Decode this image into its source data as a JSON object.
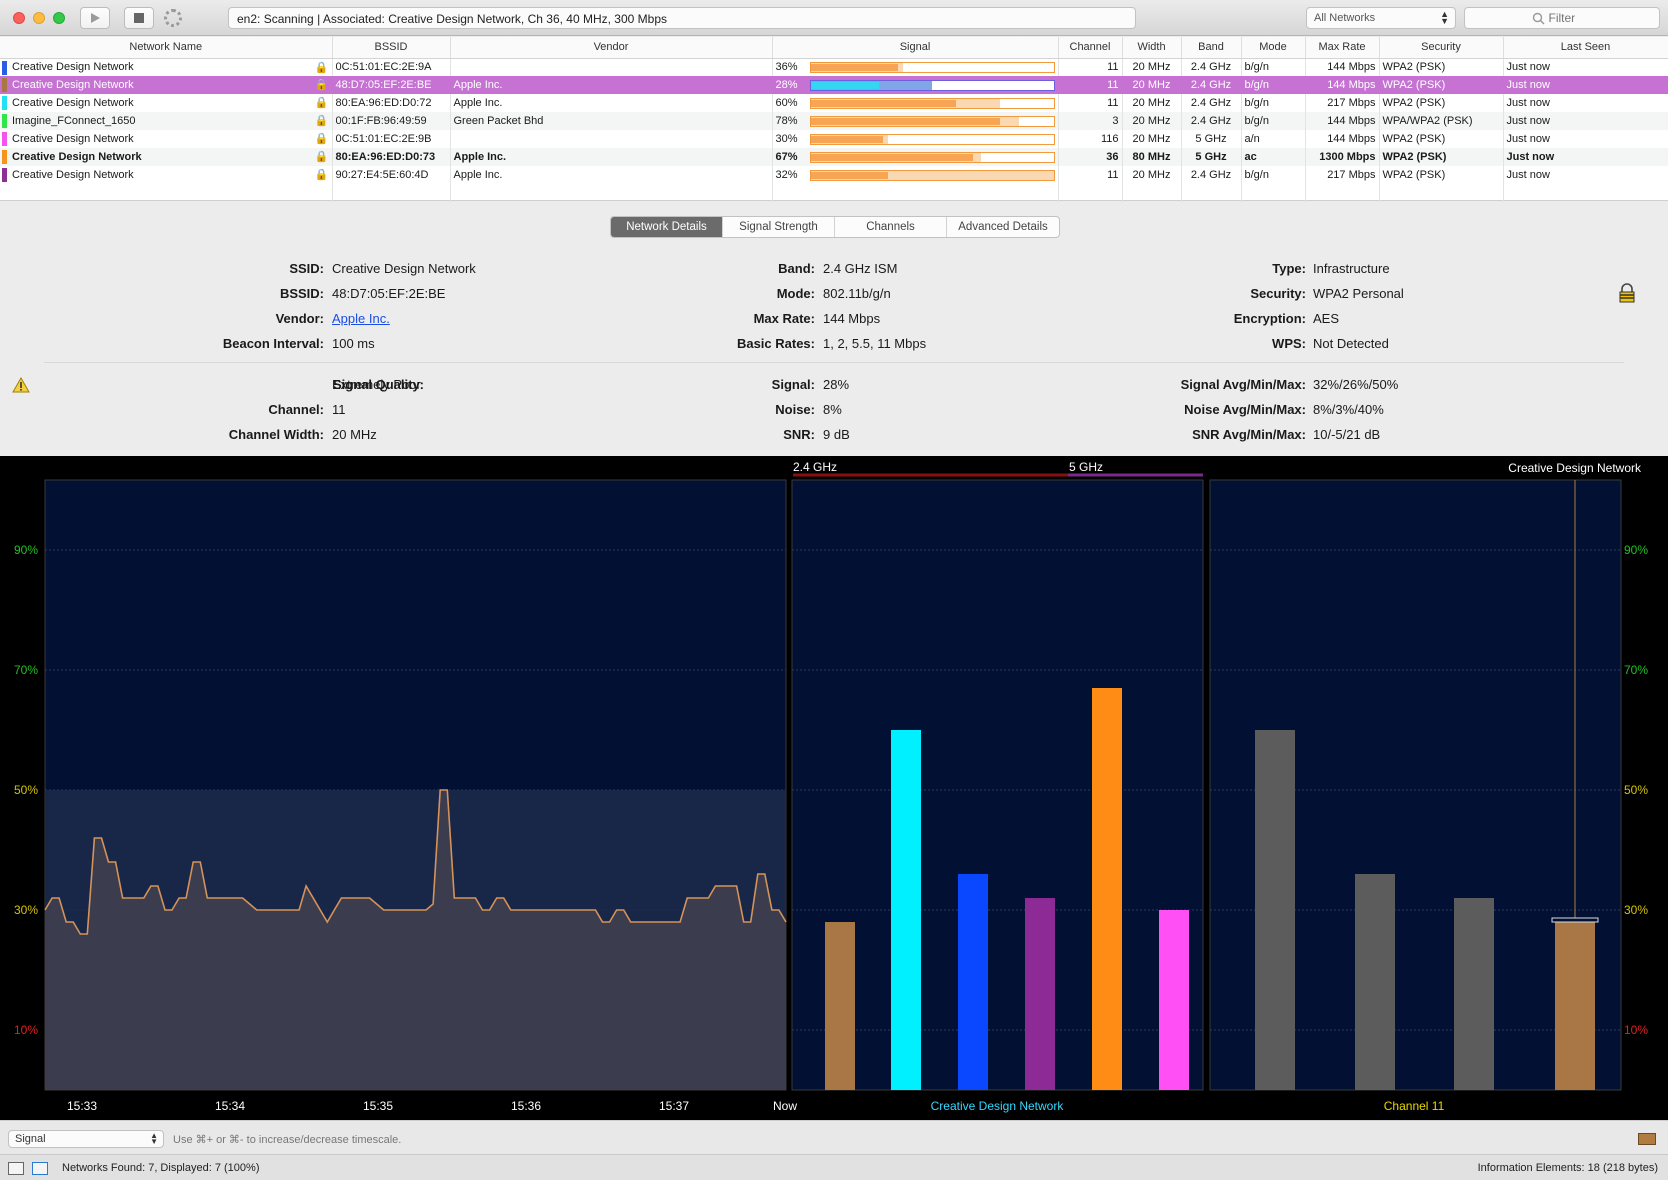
{
  "toolbar": {
    "status": "en2: Scanning  |  Associated: Creative Design Network, Ch 36, 40 MHz, 300 Mbps",
    "network_filter": "All Networks",
    "search_placeholder": "Filter"
  },
  "table": {
    "columns": [
      "Network Name",
      "BSSID",
      "Vendor",
      "Signal",
      "Channel",
      "Width",
      "Band",
      "Mode",
      "Max Rate",
      "Security",
      "Last Seen"
    ],
    "rows": [
      {
        "color": "#2b5ce6",
        "name": "Creative Design Network",
        "bssid": "0C:51:01:EC:2E:9A",
        "vendor": "",
        "signal": "36%",
        "signal_pct": 36,
        "avg_pct": 38,
        "channel": "11",
        "width": "20 MHz",
        "band": "2.4 GHz",
        "mode": "b/g/n",
        "max_rate": "144 Mbps",
        "security": "WPA2 (PSK)",
        "last_seen": "Just now"
      },
      {
        "color": "#a87745",
        "name": "Creative Design Network",
        "bssid": "48:D7:05:EF:2E:BE",
        "vendor": "Apple Inc.",
        "signal": "28%",
        "signal_pct": 28,
        "avg_pct": 50,
        "channel": "11",
        "width": "20 MHz",
        "band": "2.4 GHz",
        "mode": "b/g/n",
        "max_rate": "144 Mbps",
        "security": "WPA2 (PSK)",
        "last_seen": "Just now"
      },
      {
        "color": "#23e1f5",
        "name": "Creative Design Network",
        "bssid": "80:EA:96:ED:D0:72",
        "vendor": "Apple Inc.",
        "signal": "60%",
        "signal_pct": 60,
        "avg_pct": 78,
        "channel": "11",
        "width": "20 MHz",
        "band": "2.4 GHz",
        "mode": "b/g/n",
        "max_rate": "217 Mbps",
        "security": "WPA2 (PSK)",
        "last_seen": "Just now"
      },
      {
        "color": "#2ee64a",
        "name": "Imagine_FConnect_1650",
        "bssid": "00:1F:FB:96:49:59",
        "vendor": "Green Packet Bhd",
        "signal": "78%",
        "signal_pct": 78,
        "avg_pct": 86,
        "channel": "3",
        "width": "20 MHz",
        "band": "2.4 GHz",
        "mode": "b/g/n",
        "max_rate": "144 Mbps",
        "security": "WPA/WPA2 (PSK)",
        "last_seen": "Just now"
      },
      {
        "color": "#f552f0",
        "name": "Creative Design Network",
        "bssid": "0C:51:01:EC:2E:9B",
        "vendor": "",
        "signal": "30%",
        "signal_pct": 30,
        "avg_pct": 32,
        "channel": "116",
        "width": "20 MHz",
        "band": "5 GHz",
        "mode": "a/n",
        "max_rate": "144 Mbps",
        "security": "WPA2 (PSK)",
        "last_seen": "Just now"
      },
      {
        "color": "#f7941d",
        "name": "Creative Design Network",
        "bssid": "80:EA:96:ED:D0:73",
        "vendor": "Apple Inc.",
        "signal": "67%",
        "signal_pct": 67,
        "avg_pct": 70,
        "channel": "36",
        "width": "80 MHz",
        "band": "5 GHz",
        "mode": "ac",
        "max_rate": "1300 Mbps",
        "security": "WPA2 (PSK)",
        "last_seen": "Just now"
      },
      {
        "color": "#8e2f95",
        "name": "Creative Design Network",
        "bssid": "90:27:E4:5E:60:4D",
        "vendor": "Apple Inc.",
        "signal": "32%",
        "signal_pct": 32,
        "avg_pct": 100,
        "channel": "11",
        "width": "20 MHz",
        "band": "2.4 GHz",
        "mode": "b/g/n",
        "max_rate": "217 Mbps",
        "security": "WPA2 (PSK)",
        "last_seen": "Just now"
      }
    ]
  },
  "tabs": [
    "Network Details",
    "Signal Strength",
    "Channels",
    "Advanced Details"
  ],
  "details": {
    "ssid_label": "SSID:",
    "ssid": "Creative Design Network",
    "bssid_label": "BSSID:",
    "bssid": "48:D7:05:EF:2E:BE",
    "vendor_label": "Vendor:",
    "vendor": "Apple Inc.",
    "beacon_label": "Beacon Interval:",
    "beacon": "100 ms",
    "band_label": "Band:",
    "band": "2.4 GHz ISM",
    "mode_label": "Mode:",
    "mode": "802.11b/g/n",
    "maxrate_label": "Max Rate:",
    "maxrate": "144 Mbps",
    "basic_label": "Basic Rates:",
    "basic": "1, 2, 5.5, 11 Mbps",
    "type_label": "Type:",
    "type": "Infrastructure",
    "security_label": "Security:",
    "security": "WPA2 Personal",
    "encryption_label": "Encryption:",
    "encryption": "AES",
    "wps_label": "WPS:",
    "wps": "Not Detected",
    "quality_label": "Signal Quality:",
    "quality": "Extremely Poor",
    "channel_label": "Channel:",
    "channel": "11",
    "width_label": "Channel Width:",
    "width": "20 MHz",
    "signal_label": "Signal:",
    "signal": "28%",
    "noise_label": "Noise:",
    "noise": "8%",
    "snr_label": "SNR:",
    "snr": "9 dB",
    "sigavg_label": "Signal Avg/Min/Max:",
    "sigavg": "32%/26%/50%",
    "noiseavg_label": "Noise Avg/Min/Max:",
    "noiseavg": "8%/3%/40%",
    "snravg_label": "SNR Avg/Min/Max:",
    "snravg": "10/-5/21 dB"
  },
  "chart_data": [
    {
      "type": "line",
      "y_ticks": [
        "90%",
        "70%",
        "50%",
        "30%",
        "10%"
      ],
      "y_tick_values": [
        90,
        70,
        50,
        30,
        10
      ],
      "y_tick_colors": [
        "#21c021",
        "#21c021",
        "#d4c400",
        "#d4c400",
        "#e02020"
      ],
      "ylim": [
        0,
        100
      ],
      "x_ticks": [
        "15:33",
        "15:34",
        "15:35",
        "15:36",
        "15:37",
        "Now"
      ],
      "values": [
        30,
        32,
        32,
        28,
        28,
        26,
        26,
        42,
        42,
        38,
        38,
        32,
        32,
        32,
        32,
        34,
        34,
        30,
        30,
        32,
        32,
        38,
        38,
        32,
        32,
        32,
        32,
        32,
        32,
        31,
        30,
        30,
        30,
        30,
        30,
        30,
        30,
        34,
        32,
        30,
        28,
        30,
        32,
        32,
        32,
        32,
        32,
        31,
        30,
        30,
        30,
        30,
        30,
        30,
        30,
        31,
        50,
        50,
        32,
        32,
        32,
        32,
        30,
        30,
        32,
        32,
        30,
        30,
        30,
        30,
        30,
        30,
        30,
        30,
        30,
        30,
        30,
        30,
        30,
        28,
        28,
        30,
        30,
        28,
        28,
        28,
        28,
        28,
        28,
        28,
        28,
        32,
        32,
        32,
        32,
        34,
        34,
        34,
        34,
        28,
        28,
        36,
        36,
        30,
        30,
        28
      ],
      "band_max": 50
    },
    {
      "type": "bar",
      "groups": [
        {
          "name": "2.4 GHz",
          "color": "#8a1010"
        },
        {
          "name": "5 GHz",
          "color": "#7a2a8a"
        }
      ],
      "values": [
        28,
        60,
        36,
        32,
        67,
        30
      ],
      "colors": [
        "#a87745",
        "#00f0ff",
        "#0a48ff",
        "#8e2a95",
        "#ff8c14",
        "#ff4ff5"
      ],
      "xlabel": "Creative Design Network",
      "ylim": [
        0,
        100
      ]
    },
    {
      "type": "bar",
      "title": "Creative Design Network",
      "values": [
        60,
        36,
        32,
        28
      ],
      "colors": [
        "#5c5c5c",
        "#5c5c5c",
        "#5c5c5c",
        "#a87745"
      ],
      "xlabel": "Channel 11",
      "ylim": [
        0,
        100
      ]
    }
  ],
  "bottom": {
    "mode": "Signal",
    "hint": "Use ⌘+ or ⌘- to increase/decrease timescale.",
    "networks_found": "Networks Found: 7, Displayed: 7 (100%)",
    "info_elements": "Information Elements: 18 (218 bytes)"
  }
}
